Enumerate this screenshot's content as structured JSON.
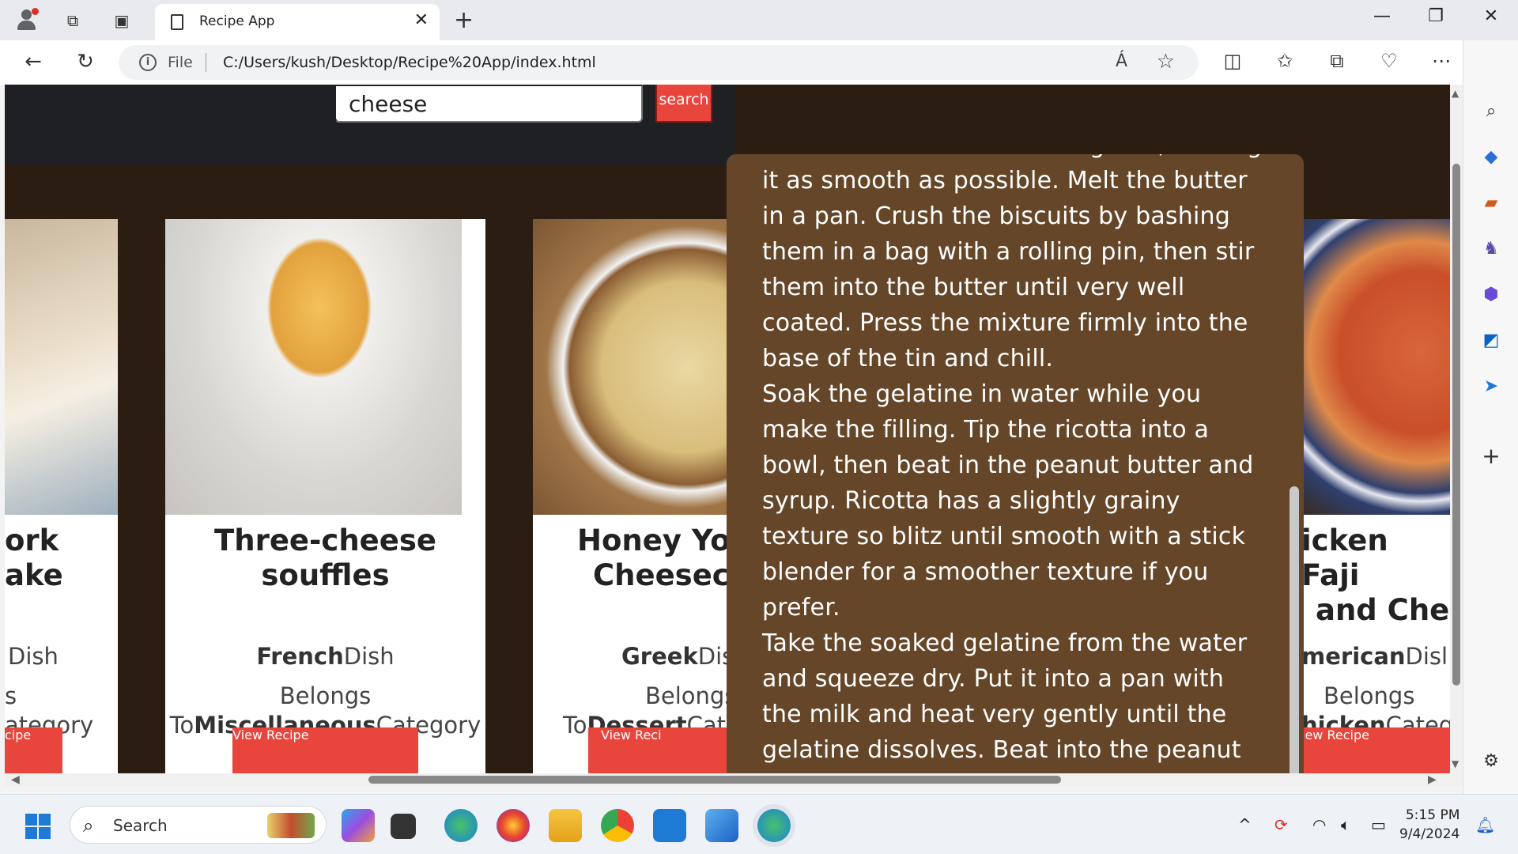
{
  "browser": {
    "tab_title": "Recipe App",
    "address_prefix": "File",
    "url": "C:/Users/kush/Desktop/Recipe%20App/index.html",
    "read_aloud_glyph": "Á"
  },
  "search": {
    "value": "cheese",
    "button_label": "search"
  },
  "cards": [
    {
      "name_line1": "ork",
      "name_line2": "ake",
      "dish_bold": "",
      "dish_suffix": "Dish",
      "belongs_line1": "s",
      "belongs_prefix": "",
      "belongs_bold": "",
      "belongs_suffix": "ategory",
      "button_label": "cipe",
      "image_colors": [
        "#d6c8b8",
        "#8aa0b0"
      ]
    },
    {
      "name_line1": "Three-cheese",
      "name_line2": "souffles",
      "dish_bold": "French",
      "dish_suffix": "Dish",
      "belongs_line1": "Belongs",
      "belongs_prefix": "To",
      "belongs_bold": "Miscellaneous",
      "belongs_suffix": "Category",
      "button_label": "View Recipe",
      "image_colors": [
        "#e9e4dd",
        "#d8a84a"
      ]
    },
    {
      "name_line1": "Honey Yo",
      "name_line2": "Cheeseca",
      "dish_bold": "Greek",
      "dish_suffix": "Dis",
      "belongs_line1": "Belongs",
      "belongs_prefix": "To",
      "belongs_bold": "Dessert",
      "belongs_suffix": "Cat",
      "button_label": "View Reci",
      "image_colors": [
        "#9a6f45",
        "#e8d9a8"
      ]
    },
    {
      "name_line1": "icken Faji",
      "name_line2": "and Che",
      "dish_bold": "merican",
      "dish_suffix": "Disl",
      "belongs_line1": "Belongs",
      "belongs_prefix": "",
      "belongs_bold": "hicken",
      "belongs_suffix": "Categ",
      "button_label": "iew Recipe",
      "image_colors": [
        "#c0562d",
        "#2f3f6e"
      ]
    }
  ],
  "recipe_popup": {
    "paragraphs": [
      "bottomed cake tin with cling film, making it as smooth as possible. Melt the butter in a pan. Crush the biscuits by bashing them in a bag with a rolling pin, then stir them into the butter until very well coated. Press the mixture firmly into the base of the tin and chill.",
      "Soak the gelatine in water while you make the filling. Tip the ricotta into a bowl, then beat in the peanut butter and syrup. Ricotta has a slightly grainy texture so blitz until smooth with a stick blender for a smoother texture if you prefer.",
      "Take the soaked gelatine from the water and squeeze dry. Put it into a pan with the milk and heat very gently until the gelatine dissolves. Beat into the peanut"
    ]
  },
  "taskbar": {
    "search_label": "Search",
    "time": "5:15 PM",
    "date": "9/4/2024"
  },
  "colors": {
    "accent_red": "#e8453c",
    "page_bg": "#2b1d12",
    "popup_bg": "#664628",
    "topbar_bg": "#1f2024"
  }
}
